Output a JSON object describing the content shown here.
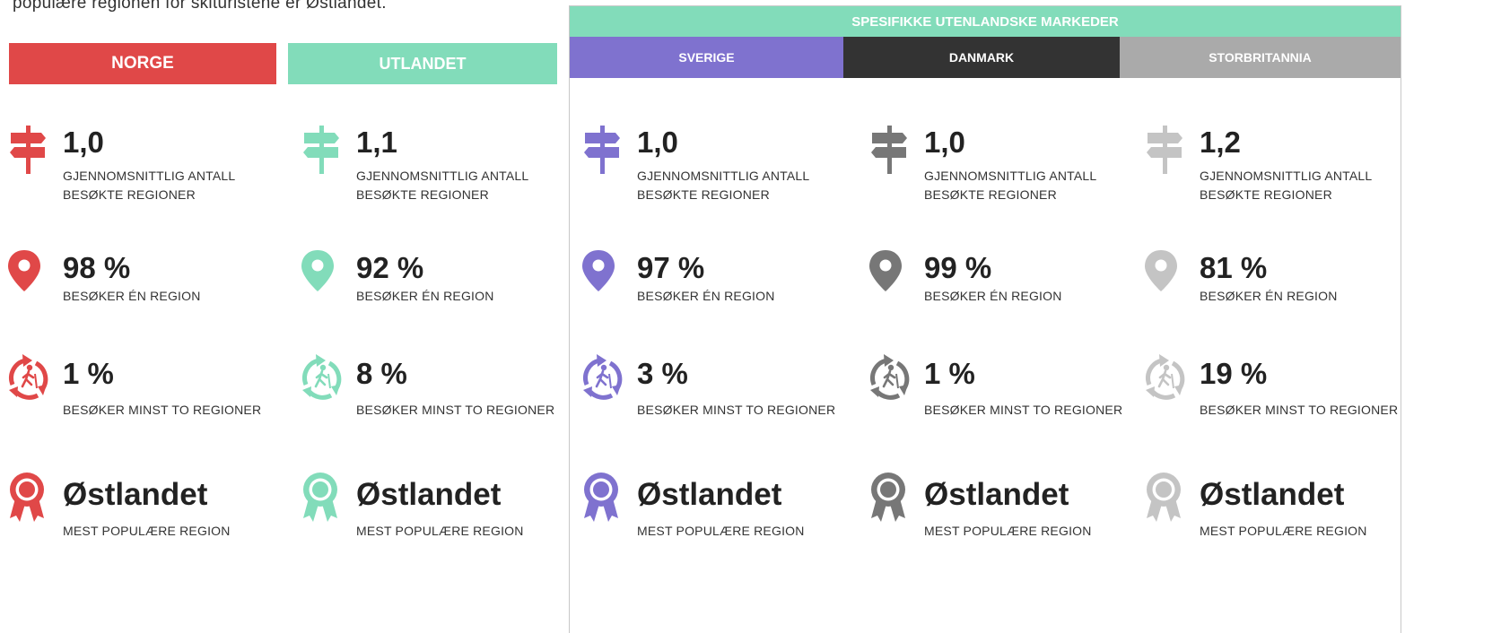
{
  "intro_text": "populære regionen for skituristene er Østlandet.",
  "headers": {
    "norge": "NORGE",
    "utlandet": "UTLANDET",
    "spesifikke": "SPESIFIKKE UTENLANDSKE MARKEDER",
    "sverige": "SVERIGE",
    "danmark": "DANMARK",
    "storbritannia": "STORBRITANNIA"
  },
  "colors": {
    "norge": "#e04848",
    "utlandet": "#82dcba",
    "sverige": "#7f72cf",
    "danmark": "#777777",
    "storbritannia": "#c4c4c4"
  },
  "labels": {
    "avg_regions_line1": "GJENNOMSNITTLIG ANTALL",
    "avg_regions_line2": "BESØKTE REGIONER",
    "one_region": "BESØKER ÉN REGION",
    "two_regions": "BESØKER MINST TO REGIONER",
    "popular_region": "MEST POPULÆRE REGION"
  },
  "icons": [
    "signpost-icon",
    "map-pin-icon",
    "hiker-cycle-icon",
    "award-ribbon-icon"
  ],
  "columns": [
    {
      "key": "norge",
      "avg_regions": "1,0",
      "one_region": "98 %",
      "two_regions": "1 %",
      "popular": "Østlandet"
    },
    {
      "key": "utlandet",
      "avg_regions": "1,1",
      "one_region": "92 %",
      "two_regions": "8 %",
      "popular": "Østlandet"
    },
    {
      "key": "sverige",
      "avg_regions": "1,0",
      "one_region": "97 %",
      "two_regions": "3 %",
      "popular": "Østlandet"
    },
    {
      "key": "danmark",
      "avg_regions": "1,0",
      "one_region": "99 %",
      "two_regions": "1 %",
      "popular": "Østlandet"
    },
    {
      "key": "storbritannia",
      "avg_regions": "1,2",
      "one_region": "81 %",
      "two_regions": "19 %",
      "popular": "Østlandet"
    }
  ]
}
